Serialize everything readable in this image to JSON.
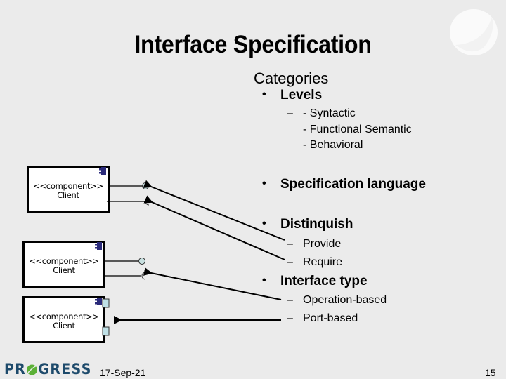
{
  "slide": {
    "title": "Interface Specification",
    "heading": "Categories",
    "bullets": [
      {
        "label": "Levels",
        "sub": [
          {
            "dash": "–",
            "lines": [
              "- Syntactic",
              "- Functional Semantic",
              "- Behavioral"
            ]
          }
        ]
      },
      {
        "label": "Specification language",
        "sub": []
      },
      {
        "label": "Distinquish",
        "sub": [
          {
            "dash": "–",
            "lines": [
              "Provide"
            ]
          },
          {
            "dash": "–",
            "lines": [
              "Require"
            ]
          }
        ]
      },
      {
        "label": "Interface type",
        "sub": [
          {
            "dash": "–",
            "lines": [
              "Operation-based"
            ]
          },
          {
            "dash": "–",
            "lines": [
              "Port-based"
            ]
          }
        ]
      }
    ],
    "bullet_glyph": "•"
  },
  "diagram": {
    "components": [
      {
        "stereotype": "<<component>>",
        "name": "Client",
        "interfaces": [
          "provided-lollipop",
          "required-socket"
        ]
      },
      {
        "stereotype": "<<component>>",
        "name": "Client",
        "interfaces": [
          "provided-lollipop",
          "required-socket"
        ]
      },
      {
        "stereotype": "<<component>>",
        "name": "Client",
        "interfaces": [
          "port",
          "port"
        ]
      }
    ],
    "colors": {
      "interface_fill": "#c8e0e0",
      "port_fill": "#bfe0e6",
      "component_icon": "#2a2a7a",
      "background": "#ebebeb"
    }
  },
  "footer": {
    "logo_text": "PROGRESS",
    "logo_accent": "#5bb036",
    "date": "17-Sep-21",
    "page_number": "15"
  }
}
